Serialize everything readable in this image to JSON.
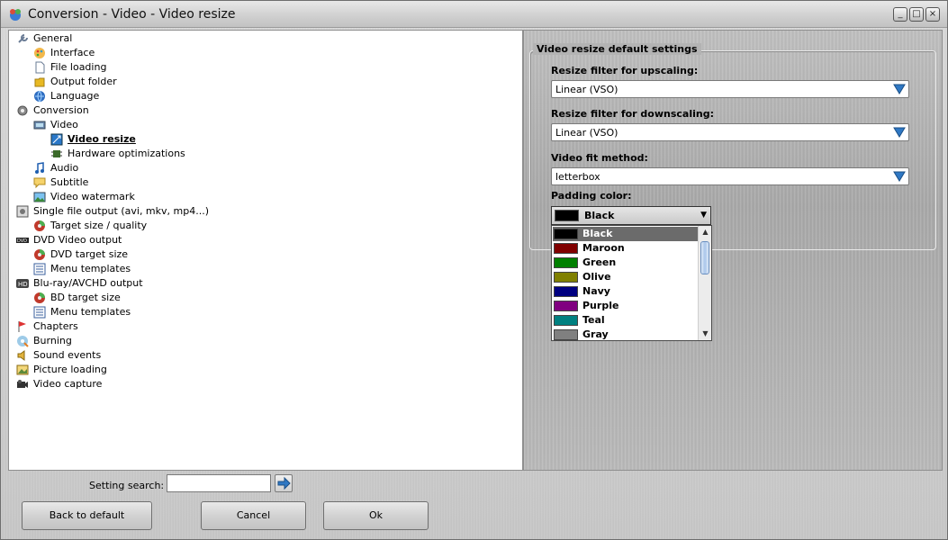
{
  "window": {
    "title": "Conversion - Video - Video resize",
    "controls": {
      "minimize": "_",
      "maximize": "□",
      "close": "×"
    }
  },
  "tree": [
    {
      "label": "General",
      "level": 0,
      "icon": "wrench-icon"
    },
    {
      "label": "Interface",
      "level": 1,
      "icon": "palette-icon"
    },
    {
      "label": "File loading",
      "level": 1,
      "icon": "file-icon"
    },
    {
      "label": "Output folder",
      "level": 1,
      "icon": "folder-icon"
    },
    {
      "label": "Language",
      "level": 1,
      "icon": "globe-icon"
    },
    {
      "label": "Conversion",
      "level": 0,
      "icon": "gear-icon"
    },
    {
      "label": "Video",
      "level": 1,
      "icon": "video-icon"
    },
    {
      "label": "Video resize",
      "level": 2,
      "icon": "resize-icon",
      "selected": true
    },
    {
      "label": "Hardware optimizations",
      "level": 2,
      "icon": "chip-icon"
    },
    {
      "label": "Audio",
      "level": 1,
      "icon": "music-note-icon"
    },
    {
      "label": "Subtitle",
      "level": 1,
      "icon": "speech-bubble-icon"
    },
    {
      "label": "Video watermark",
      "level": 1,
      "icon": "image-icon"
    },
    {
      "label": "Single file output (avi, mkv, mp4...)",
      "level": 0,
      "icon": "film-icon"
    },
    {
      "label": "Target size / quality",
      "level": 1,
      "icon": "disc-icon"
    },
    {
      "label": "DVD Video output",
      "level": 0,
      "icon": "dvd-icon"
    },
    {
      "label": "DVD target size",
      "level": 1,
      "icon": "disc-icon"
    },
    {
      "label": "Menu templates",
      "level": 1,
      "icon": "menu-list-icon"
    },
    {
      "label": "Blu-ray/AVCHD output",
      "level": 0,
      "icon": "hd-icon"
    },
    {
      "label": "BD target size",
      "level": 1,
      "icon": "disc-icon"
    },
    {
      "label": "Menu templates",
      "level": 1,
      "icon": "menu-list-icon"
    },
    {
      "label": "Chapters",
      "level": 0,
      "icon": "flag-icon"
    },
    {
      "label": "Burning",
      "level": 0,
      "icon": "burn-icon"
    },
    {
      "label": "Sound events",
      "level": 0,
      "icon": "speaker-icon"
    },
    {
      "label": "Picture loading",
      "level": 0,
      "icon": "picture-icon"
    },
    {
      "label": "Video capture",
      "level": 0,
      "icon": "camera-icon"
    }
  ],
  "settings": {
    "group_title": "Video resize default settings",
    "upscaling_label": "Resize filter for upscaling:",
    "upscaling_value": "Linear (VSO)",
    "downscaling_label": "Resize filter for downscaling:",
    "downscaling_value": "Linear (VSO)",
    "fit_label": "Video fit method:",
    "fit_value": "letterbox",
    "padding_label": "Padding color:",
    "padding_value": "Black",
    "padding_value_color": "#000000"
  },
  "color_options": [
    {
      "name": "Black",
      "color": "#000000",
      "active": true
    },
    {
      "name": "Maroon",
      "color": "#800000"
    },
    {
      "name": "Green",
      "color": "#008000"
    },
    {
      "name": "Olive",
      "color": "#808000"
    },
    {
      "name": "Navy",
      "color": "#000080"
    },
    {
      "name": "Purple",
      "color": "#800080"
    },
    {
      "name": "Teal",
      "color": "#008080"
    },
    {
      "name": "Gray",
      "color": "#808080"
    }
  ],
  "bottom": {
    "search_label": "Setting search:",
    "search_value": "",
    "back_to_default": "Back to default",
    "cancel": "Cancel",
    "ok": "Ok"
  }
}
